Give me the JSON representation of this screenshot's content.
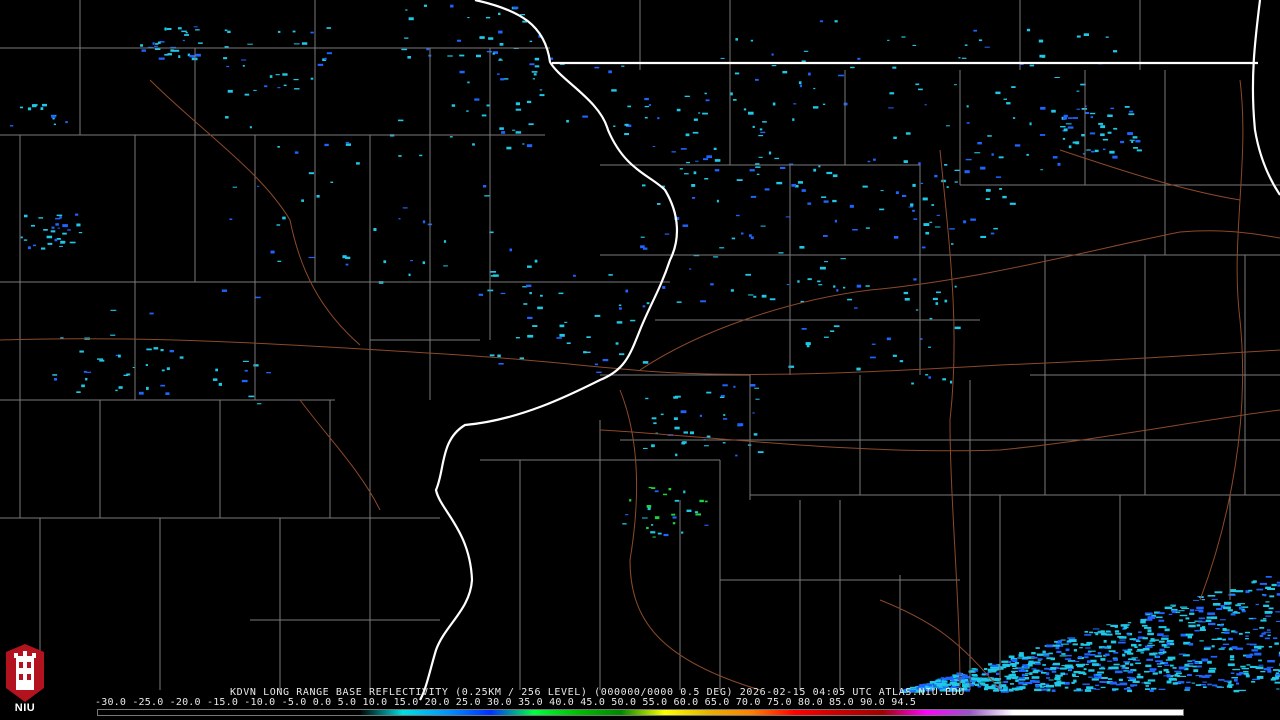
{
  "radar": {
    "site": "KDVN",
    "caption": "KDVN LONG RANGE BASE REFLECTIVITY (0.25KM / 256 LEVEL) (000000/0000 0.5 DEG) 2026-02-15 04:05 UTC  ATLAS.NIU.EDU",
    "scale_labels": "-30.0 -25.0 -20.0 -15.0 -10.0 -5.0  0.0  5.0  10.0  15.0  20.0  25.0  30.0  35.0  40.0  45.0  50.0  55.0  60.0  65.0  70.0  75.0  80.0  85.0  90.0  94.5"
  },
  "scale": {
    "min_dbz": -30.0,
    "max_dbz": 94.5,
    "stops": [
      {
        "dbz": -30,
        "color": "#000000"
      },
      {
        "dbz": 0,
        "color": "#000000"
      },
      {
        "dbz": 5,
        "color": "#00e0e0"
      },
      {
        "dbz": 10,
        "color": "#0096ff"
      },
      {
        "dbz": 15,
        "color": "#0030ff"
      },
      {
        "dbz": 20,
        "color": "#00ff40"
      },
      {
        "dbz": 25,
        "color": "#00c000"
      },
      {
        "dbz": 30,
        "color": "#008800"
      },
      {
        "dbz": 35,
        "color": "#ffff00"
      },
      {
        "dbz": 40,
        "color": "#e6b400"
      },
      {
        "dbz": 45,
        "color": "#ff8000"
      },
      {
        "dbz": 50,
        "color": "#ff0000"
      },
      {
        "dbz": 55,
        "color": "#c80000"
      },
      {
        "dbz": 60,
        "color": "#a00000"
      },
      {
        "dbz": 65,
        "color": "#ff00ff"
      },
      {
        "dbz": 70,
        "color": "#9955c9"
      },
      {
        "dbz": 75,
        "color": "#ffffff"
      },
      {
        "dbz": 94.5,
        "color": "#ffffff"
      }
    ]
  },
  "colors": {
    "background": "#000000",
    "state_border": "#ffffff",
    "county_line": "#7a7a7a",
    "highway": "#8b4a2a",
    "echo_light": "#1ec8e6",
    "echo_mid": "#1e64ff",
    "echo_strong": "#20d040"
  },
  "logo": {
    "text": "NIU",
    "color": "#b3121f"
  }
}
